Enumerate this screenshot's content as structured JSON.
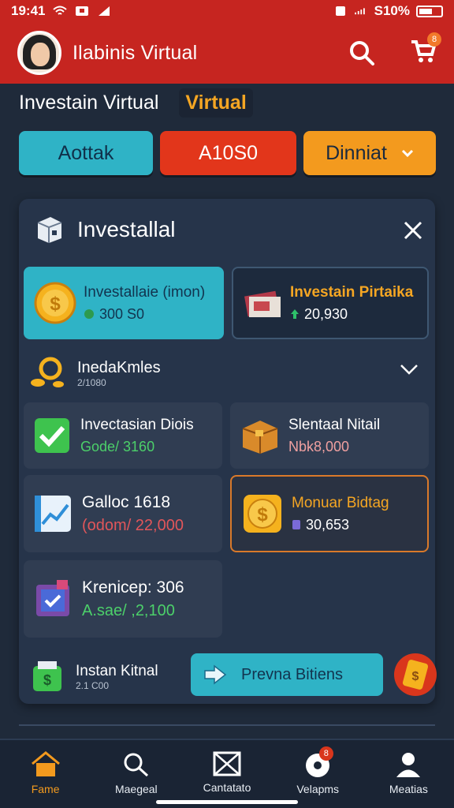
{
  "status_bar": {
    "time": "19:41",
    "battery": "S10%"
  },
  "app_bar": {
    "title": "Ilabinis Virtual",
    "cart_badge": "8"
  },
  "sub_header": {
    "title": "Investain Virtual",
    "badge": "Virtual"
  },
  "quick_buttons": [
    {
      "label": "Aottak"
    },
    {
      "label": "A10S0"
    },
    {
      "label": "Dinniat"
    }
  ],
  "panel": {
    "title": "Investallal",
    "cards_top": [
      {
        "title": "Investallaie (imon)",
        "value": "300 S0"
      },
      {
        "title": "Investain Pirtaika",
        "value": "20,930"
      }
    ],
    "section": {
      "title": "InedaKmles",
      "subtitle": "2/1080"
    },
    "grid": [
      {
        "title": "Invectasian Diois",
        "value": "Gode/  3160"
      },
      {
        "title": "Slentaal Nitail",
        "value": "Nbk8,000"
      },
      {
        "title": "Galloc 1618",
        "value": "(odom/ 22,000"
      },
      {
        "title": "Monuar Bidtag",
        "value": "30,653"
      },
      {
        "title": "Krenicep: 306",
        "value": "A.sae/ ,2,100"
      }
    ],
    "bottom": {
      "title": "Instan Kitnal",
      "subtitle": "2.1 C00",
      "cta": "Prevna Bitiens"
    }
  },
  "bottom_nav": [
    {
      "label": "Fame"
    },
    {
      "label": "Maegeal"
    },
    {
      "label": "Cantatato"
    },
    {
      "label": "Velapms",
      "badge": "8"
    },
    {
      "label": "Meatias"
    }
  ],
  "colors": {
    "brand": "#c62520",
    "accent_teal": "#2fb3c6",
    "accent_orange": "#f39a1e",
    "accent_red": "#e2361b",
    "background": "#1f2a3a"
  }
}
